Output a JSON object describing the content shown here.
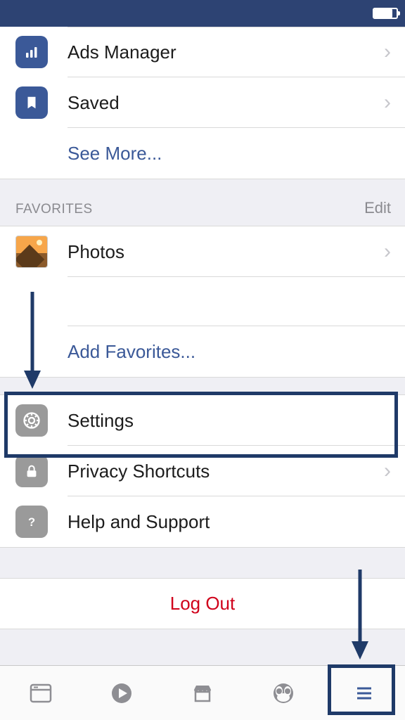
{
  "menu": {
    "items": [
      {
        "icon": "bar-chart-icon",
        "label": "Ads Manager",
        "chevron": true
      },
      {
        "icon": "bookmark-icon",
        "label": "Saved",
        "chevron": true
      }
    ],
    "see_more": "See More..."
  },
  "favorites": {
    "header": "FAVORITES",
    "edit": "Edit",
    "items": [
      {
        "icon": "photos-icon",
        "label": "Photos",
        "chevron": true
      }
    ],
    "add": "Add Favorites..."
  },
  "settings_section": {
    "items": [
      {
        "icon": "gear-icon",
        "label": "Settings",
        "chevron": false
      },
      {
        "icon": "lock-icon",
        "label": "Privacy Shortcuts",
        "chevron": true
      },
      {
        "icon": "question-icon",
        "label": "Help and Support",
        "chevron": false
      }
    ]
  },
  "logout": "Log Out",
  "colors": {
    "fb_blue": "#3b5998",
    "dark_blue": "#2d4373",
    "annot": "#1f3a68",
    "gray_icon": "#9a9a9a",
    "logout_red": "#d0021b"
  }
}
